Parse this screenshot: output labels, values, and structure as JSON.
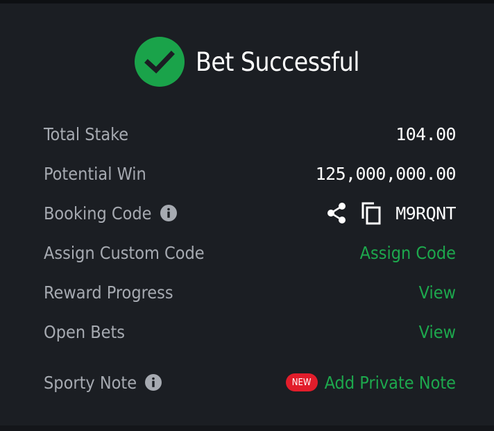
{
  "header": {
    "title": "Bet Successful",
    "icon": "check-circle-icon",
    "accent_color": "#1aa34a"
  },
  "rows": {
    "total_stake": {
      "label": "Total Stake",
      "value": "104.00"
    },
    "potential_win": {
      "label": "Potential Win",
      "value": "125,000,000.00"
    },
    "booking_code": {
      "label": "Booking Code",
      "value": "M9RQNT",
      "icons": [
        "info-icon",
        "share-icon",
        "copy-icon"
      ]
    },
    "assign_custom_code": {
      "label": "Assign Custom Code",
      "action": "Assign Code"
    },
    "reward_progress": {
      "label": "Reward Progress",
      "action": "View"
    },
    "open_bets": {
      "label": "Open Bets",
      "action": "View"
    },
    "sporty_note": {
      "label": "Sporty Note",
      "badge": "NEW",
      "action": "Add Private Note"
    }
  },
  "colors": {
    "background": "#1b1e23",
    "link_green": "#1da84d",
    "badge_red": "#e21d2b",
    "label_gray": "#a6aab1"
  }
}
